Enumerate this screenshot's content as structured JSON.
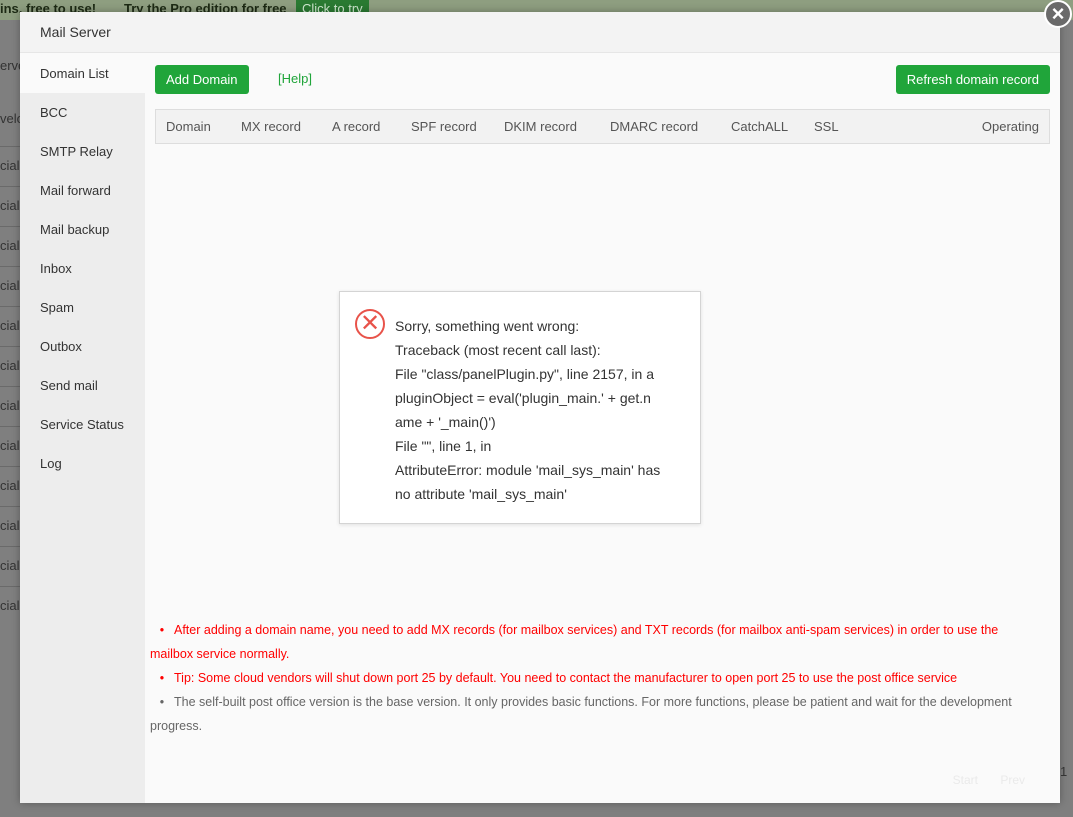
{
  "background": {
    "banner_left": "ins, free to use!",
    "banner_pro": "Try the Pro edition for free",
    "banner_try": "Click to try",
    "fragments": [
      "erver",
      "velo",
      "cial",
      "cial",
      "cial",
      "cial",
      "cial",
      "cial",
      "cial",
      "cial",
      "cial",
      "cial",
      "cial",
      "cial"
    ],
    "pagination": {
      "start": "Start",
      "prev": "Prev",
      "page": "1"
    }
  },
  "modal": {
    "title": "Mail Server",
    "close_icon": "close-icon"
  },
  "sidebar": {
    "items": [
      {
        "label": "Domain List",
        "active": true
      },
      {
        "label": "BCC"
      },
      {
        "label": "SMTP Relay"
      },
      {
        "label": "Mail forward"
      },
      {
        "label": "Mail backup"
      },
      {
        "label": "Inbox"
      },
      {
        "label": "Spam"
      },
      {
        "label": "Outbox"
      },
      {
        "label": "Send mail"
      },
      {
        "label": "Service Status"
      },
      {
        "label": "Log"
      }
    ]
  },
  "toolbar": {
    "add_domain": "Add Domain",
    "help": "[Help]",
    "refresh": "Refresh domain record"
  },
  "table": {
    "columns": [
      "Domain",
      "MX record",
      "A record",
      "SPF record",
      "DKIM record",
      "DMARC record",
      "CatchALL",
      "SSL",
      "Operating"
    ]
  },
  "error": {
    "icon": "error-circle-x-icon",
    "lines": [
      "Sorry, something went wrong:",
      "Traceback (most recent call last):",
      "File \"class/panelPlugin.py\", line 2157, in a",
      "pluginObject = eval('plugin_main.' + get.n",
      "ame + '_main()')",
      "File \"\", line 1, in",
      "AttributeError: module 'mail_sys_main' has",
      "no attribute 'mail_sys_main'"
    ]
  },
  "notes": [
    {
      "text": "After adding a domain name, you need to add MX records (for mailbox services) and TXT records (for mailbox anti-spam services) in order to use the mailbox service normally.",
      "color": "#ff0000"
    },
    {
      "text": "Tip: Some cloud vendors will shut down port 25 by default. You need to contact the manufacturer to open port 25 to use the post office service",
      "color": "#ff0000"
    },
    {
      "text": "The self-built post office version is the base version. It only provides basic functions. For more functions, please be patient and wait for the development progress.",
      "color": "#666666"
    }
  ],
  "colors": {
    "accent": "#20a53a",
    "error": "#e8534a",
    "warning": "#ff0000"
  }
}
